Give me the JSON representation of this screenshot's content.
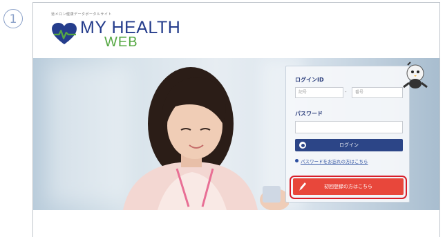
{
  "step": {
    "number": "1"
  },
  "header": {
    "tagline": "道メロン健康データポータルサイト",
    "logo_main": "MY HEALTH",
    "logo_sub": "WEB"
  },
  "login": {
    "id_label": "ログインID",
    "id_placeholder_1": "記号",
    "id_placeholder_2": "番号",
    "id_separator": "-",
    "password_label": "パスワード",
    "login_button": "ログイン",
    "forgot_link": "パスワードをお忘れの方はこちら",
    "register_button": "初回登録の方はこちら"
  },
  "colors": {
    "brand_blue": "#253d8c",
    "brand_green": "#56a843",
    "register_red": "#e8473b",
    "highlight_red": "#d81e2a"
  },
  "icons": [
    "heart-logo-icon",
    "mascot-icon",
    "login-circle-icon",
    "bullet-icon",
    "pencil-icon"
  ]
}
